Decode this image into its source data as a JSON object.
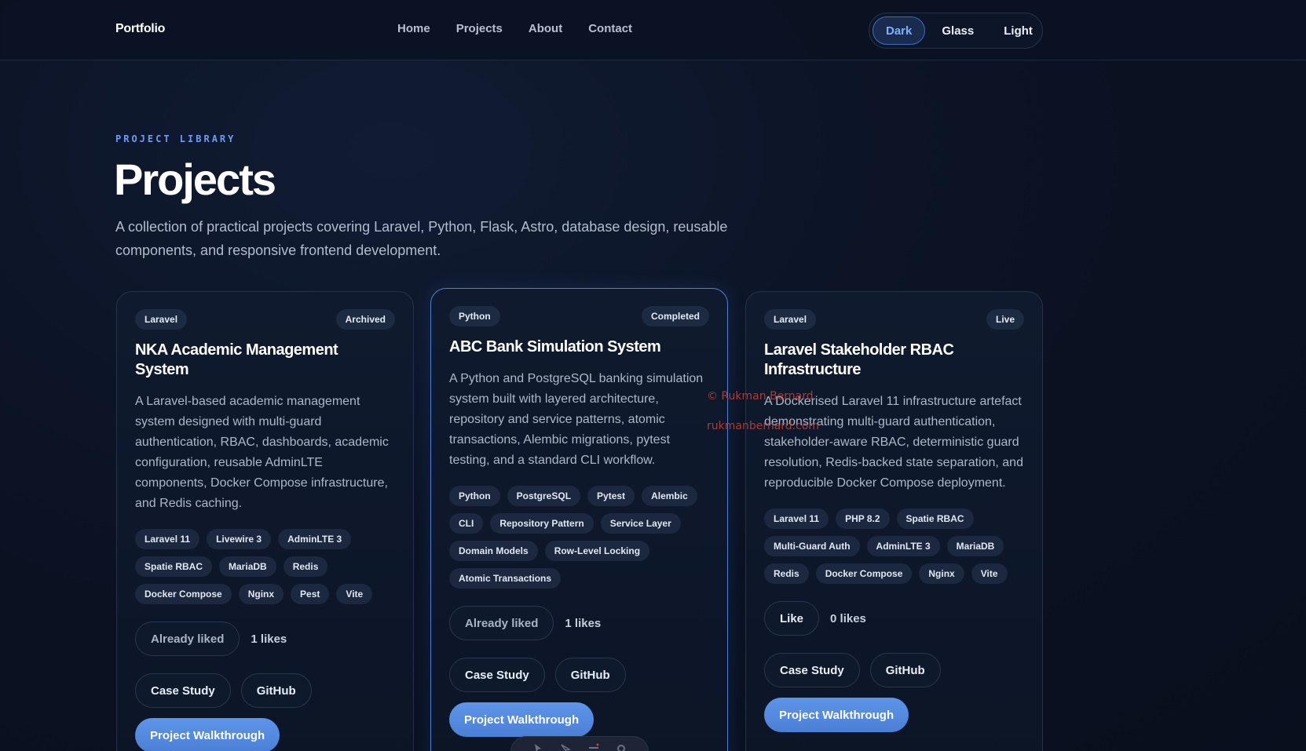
{
  "nav": {
    "brand": "Portfolio",
    "links": [
      "Home",
      "Projects",
      "About",
      "Contact"
    ],
    "themes": [
      "Dark",
      "Glass",
      "Light"
    ],
    "active_theme": "Dark"
  },
  "hero": {
    "eyebrow": "PROJECT LIBRARY",
    "title": "Projects",
    "description": "A collection of practical projects covering Laravel, Python, Flask, Astro, database design, reusable components, and responsive frontend development."
  },
  "projects": [
    {
      "category": "Laravel",
      "status": "Archived",
      "title": "NKA Academic Management System",
      "description": "A Laravel-based academic management system designed with multi-guard authentication, RBAC, dashboards, academic configuration, reusable AdminLTE components, Docker Compose infrastructure, and Redis caching.",
      "tags": [
        "Laravel 11",
        "Livewire 3",
        "AdminLTE 3",
        "Spatie RBAC",
        "MariaDB",
        "Redis",
        "Docker Compose",
        "Nginx",
        "Pest",
        "Vite"
      ],
      "like_label": "Already liked",
      "likes": "1 likes",
      "case_study": "Case Study",
      "github": "GitHub",
      "walkthrough": "Project Walkthrough"
    },
    {
      "category": "Python",
      "status": "Completed",
      "title": "ABC Bank Simulation System",
      "description": "A Python and PostgreSQL banking simulation system built with layered architecture, repository and service patterns, atomic transactions, Alembic migrations, pytest testing, and a standard CLI workflow.",
      "tags": [
        "Python",
        "PostgreSQL",
        "Pytest",
        "Alembic",
        "CLI",
        "Repository Pattern",
        "Service Layer",
        "Domain Models",
        "Row-Level Locking",
        "Atomic Transactions"
      ],
      "like_label": "Already liked",
      "likes": "1 likes",
      "case_study": "Case Study",
      "github": "GitHub",
      "walkthrough": "Project Walkthrough"
    },
    {
      "category": "Laravel",
      "status": "Live",
      "title": "Laravel Stakeholder RBAC Infrastructure",
      "description": "A Dockerised Laravel 11 infrastructure artefact demonstrating multi-guard authentication, stakeholder-aware RBAC, deterministic guard resolution, Redis-backed state separation, and reproducible Docker Compose deployment.",
      "tags": [
        "Laravel 11",
        "PHP 8.2",
        "Spatie RBAC",
        "Multi-Guard Auth",
        "AdminLTE 3",
        "MariaDB",
        "Redis",
        "Docker Compose",
        "Nginx",
        "Vite"
      ],
      "like_label": "Like",
      "likes": "0 likes",
      "case_study": "Case Study",
      "github": "GitHub",
      "walkthrough": "Project Walkthrough"
    }
  ],
  "watermark": {
    "line1": "© Rukman Bernard",
    "line2": "rukmanbernard.com"
  },
  "colors": {
    "accent": "#5e95e8",
    "background": "#0b1324",
    "watermark": "#c0443c"
  }
}
